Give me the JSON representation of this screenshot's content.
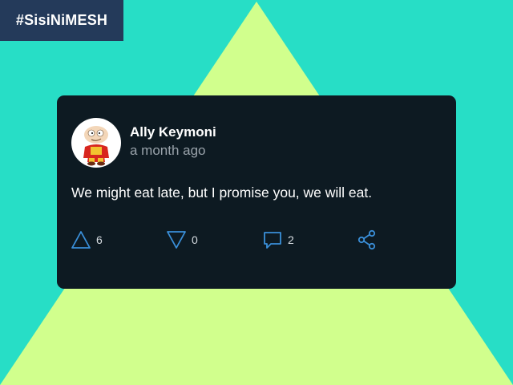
{
  "hashtag": "#SisiNiMESH",
  "post": {
    "author": "Ally Keymoni",
    "timestamp": "a month ago",
    "text": "We might eat late, but I promise you, we will eat.",
    "avatar_icon": "cartoon-character-avatar"
  },
  "actions": {
    "upvote": {
      "icon": "triangle-up-icon",
      "count": "6"
    },
    "downvote": {
      "icon": "triangle-down-icon",
      "count": "0"
    },
    "comment": {
      "icon": "speech-bubble-icon",
      "count": "2"
    },
    "share": {
      "icon": "share-icon"
    }
  },
  "colors": {
    "background": "#27dec6",
    "triangle": "#d1ff8d",
    "hashtag_bg": "#243a5a",
    "card_bg": "#0d1a22",
    "icon_accent": "#3a8fd9"
  }
}
